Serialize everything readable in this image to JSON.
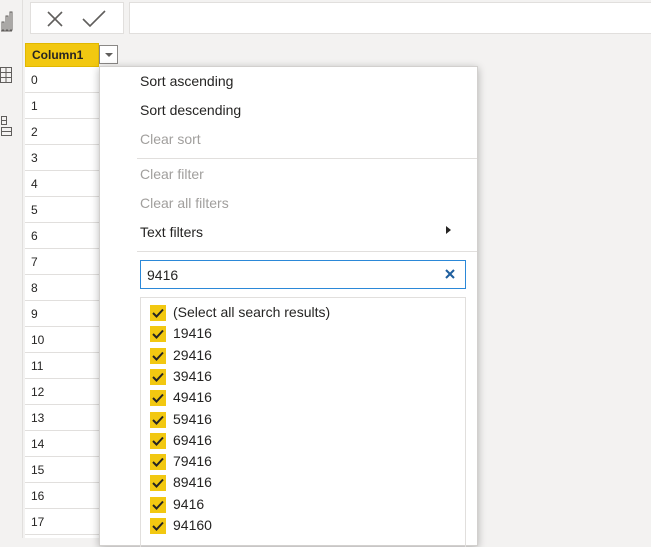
{
  "left_rail": {
    "icons": [
      "report-view-icon",
      "data-view-icon",
      "model-view-icon"
    ]
  },
  "formula_bar": {
    "cancel_icon": "close-icon",
    "commit_icon": "checkmark-icon",
    "value": ""
  },
  "grid": {
    "column_header": "Column1",
    "rows": [
      "0",
      "1",
      "2",
      "3",
      "4",
      "5",
      "6",
      "7",
      "8",
      "9",
      "10",
      "11",
      "12",
      "13",
      "14",
      "15",
      "16",
      "17"
    ]
  },
  "filter_menu": {
    "sort_ascending": "Sort ascending",
    "sort_descending": "Sort descending",
    "clear_sort": "Clear sort",
    "clear_filter": "Clear filter",
    "clear_all_filters": "Clear all filters",
    "text_filters": "Text filters",
    "search": {
      "value": "9416",
      "clear_icon": "clear-icon"
    },
    "results": [
      "(Select all search results)",
      "19416",
      "29416",
      "39416",
      "49416",
      "59416",
      "69416",
      "79416",
      "89416",
      "9416",
      "94160"
    ]
  },
  "colors": {
    "accent": "#f2c811",
    "focus": "#2b88d8",
    "disabled_text": "#a19f9d"
  }
}
